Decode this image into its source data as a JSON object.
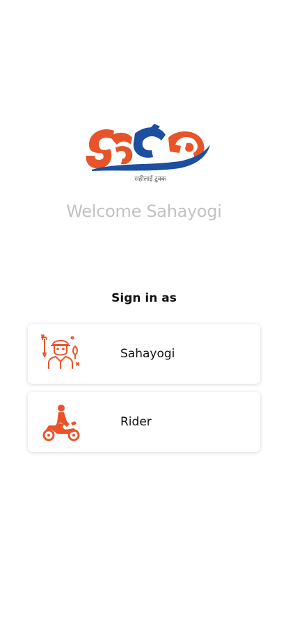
{
  "logo": {
    "tagline": "सहीलाई टुक्क",
    "colors": {
      "orange": "#e8542a",
      "blue": "#1c4fa0"
    }
  },
  "welcome": {
    "title": "Welcome Sahayogi"
  },
  "signin": {
    "heading": "Sign in as",
    "options": [
      {
        "label": "Sahayogi",
        "icon": "mechanic-icon"
      },
      {
        "label": "Rider",
        "icon": "motorbike-rider-icon"
      }
    ]
  },
  "theme": {
    "accent": "#e8542a",
    "muted_text": "#c2c2c2",
    "text": "#111111"
  }
}
